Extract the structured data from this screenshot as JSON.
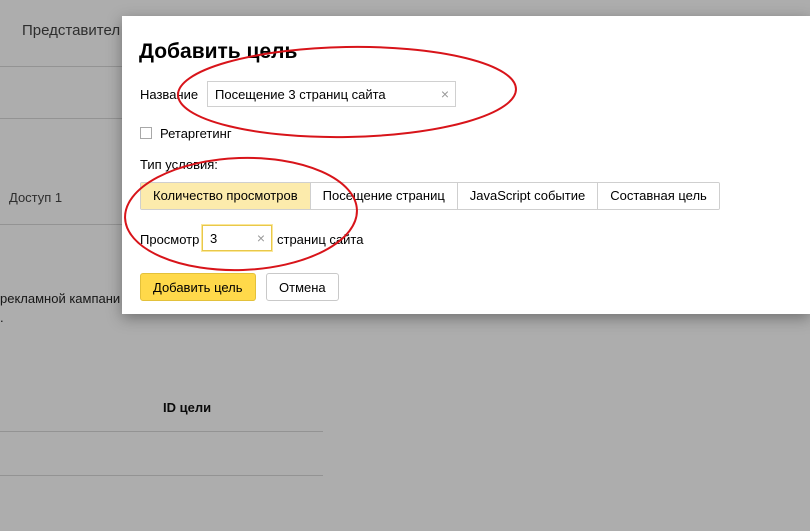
{
  "background": {
    "tab_label": "Представител",
    "access_label": "Доступ 1",
    "campaign_text": "рекламной кампани",
    "dot_text": ".",
    "id_column_header": "ID цели"
  },
  "dialog": {
    "title": "Добавить цель",
    "name_label": "Название",
    "name_value": "Посещение 3 страниц сайта",
    "clear_icon": "×",
    "retargeting_label": "Ретаргетинг",
    "condition_type_label": "Тип условия:",
    "condition_tabs": [
      {
        "label": "Количество просмотров",
        "active": true
      },
      {
        "label": "Посещение страниц",
        "active": false
      },
      {
        "label": "JavaScript событие",
        "active": false
      },
      {
        "label": "Составная цель",
        "active": false
      }
    ],
    "views_label": "Просмотр",
    "views_value": "3",
    "views_suffix": "страниц сайта",
    "add_button": "Добавить цель",
    "cancel_button": "Отмена"
  },
  "colors": {
    "primary_button": "#ffd94a",
    "active_tab": "#fcebac",
    "annotation_ellipse": "#d8141a"
  }
}
